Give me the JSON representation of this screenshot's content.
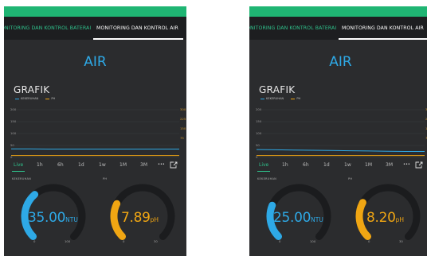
{
  "screens": [
    {
      "tabs": {
        "battery": "ONITORING DAN KONTROL BATERAI",
        "water": "MONITORING DAN KONTROL AIR"
      },
      "title": "AIR",
      "chart_title": "GRAFIK",
      "legend": {
        "series1": "KEKERUHAN",
        "series2": "PH"
      },
      "time_ranges": [
        "Live",
        "1h",
        "6h",
        "1d",
        "1w",
        "1M",
        "3M"
      ],
      "more_icon": "more-icon",
      "share_icon": "export-icon",
      "turbidity": {
        "label": "KEKERUHAN",
        "value": "35.00",
        "unit": "NTU",
        "min": "0",
        "max": "100",
        "fraction": 0.35,
        "color": "#2ea9e6"
      },
      "ph": {
        "label": "PH",
        "value": "7.89",
        "unit": "pH",
        "min": "0",
        "max": "30",
        "fraction": 0.263,
        "color": "#f0a613"
      }
    },
    {
      "tabs": {
        "battery": "ONITORING DAN KONTROL BATERAI",
        "water": "MONITORING DAN KONTROL AIR"
      },
      "title": "AIR",
      "chart_title": "GRAFIK",
      "legend": {
        "series1": "KEKERUHAN",
        "series2": "PH"
      },
      "time_ranges": [
        "Live",
        "1h",
        "6h",
        "1d",
        "1w",
        "1M",
        "3M"
      ],
      "more_icon": "more-icon",
      "share_icon": "export-icon",
      "turbidity": {
        "label": "KEKERUHAN",
        "value": "25.00",
        "unit": "NTU",
        "min": "0",
        "max": "100",
        "fraction": 0.25,
        "color": "#2ea9e6"
      },
      "ph": {
        "label": "PH",
        "value": "8.20",
        "unit": "pH",
        "min": "0",
        "max": "30",
        "fraction": 0.273,
        "color": "#f0a613"
      }
    }
  ],
  "chart_data": [
    {
      "type": "line",
      "title": "GRAFIK",
      "y_left_ticks": [
        "200",
        "150",
        "100",
        "50",
        "0"
      ],
      "y_right_ticks": [
        "300",
        "225",
        "150",
        "75"
      ],
      "ylim_left": [
        0,
        200
      ],
      "ylim_right": [
        0,
        300
      ],
      "series": [
        {
          "name": "KEKERUHAN",
          "color": "#2ea9e6",
          "values": [
            36,
            36,
            35,
            35,
            35,
            35,
            35,
            35,
            35,
            35
          ]
        },
        {
          "name": "PH",
          "color": "#f0a613",
          "values": [
            8,
            8,
            8,
            8,
            8,
            8,
            8,
            8,
            8,
            8
          ]
        }
      ]
    },
    {
      "type": "line",
      "title": "GRAFIK",
      "y_left_ticks": [
        "200",
        "150",
        "100",
        "50",
        "0"
      ],
      "y_right_ticks": [
        "300",
        "225",
        "150",
        "75"
      ],
      "ylim_left": [
        0,
        200
      ],
      "ylim_right": [
        0,
        300
      ],
      "series": [
        {
          "name": "KEKERUHAN",
          "color": "#2ea9e6",
          "values": [
            33,
            32,
            31,
            30,
            29,
            28,
            27,
            26,
            25,
            25
          ]
        },
        {
          "name": "PH",
          "color": "#f0a613",
          "values": [
            8,
            8,
            8,
            8,
            8,
            8,
            8,
            8,
            8,
            8
          ]
        }
      ]
    }
  ]
}
